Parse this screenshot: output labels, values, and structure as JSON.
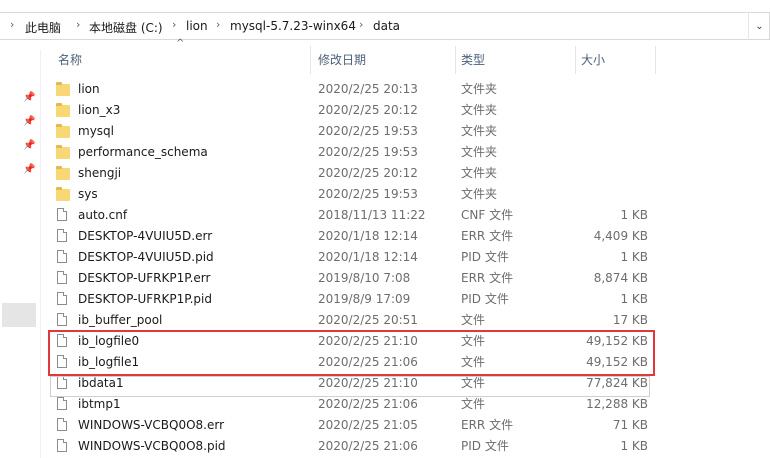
{
  "breadcrumb": {
    "items": [
      "此电脑",
      "本地磁盘 (C:)",
      "lion",
      "mysql-5.7.23-winx64",
      "data"
    ]
  },
  "columns": {
    "name": "名称",
    "modified": "修改日期",
    "type": "类型",
    "size": "大小"
  },
  "rows": [
    {
      "name": "lion",
      "modified": "2020/2/25 20:13",
      "type": "文件夹",
      "size": "",
      "icon": "folder-icon"
    },
    {
      "name": "lion_x3",
      "modified": "2020/2/25 20:12",
      "type": "文件夹",
      "size": "",
      "icon": "folder-icon"
    },
    {
      "name": "mysql",
      "modified": "2020/2/25 19:53",
      "type": "文件夹",
      "size": "",
      "icon": "folder-icon"
    },
    {
      "name": "performance_schema",
      "modified": "2020/2/25 19:53",
      "type": "文件夹",
      "size": "",
      "icon": "folder-icon"
    },
    {
      "name": "shengji",
      "modified": "2020/2/25 20:12",
      "type": "文件夹",
      "size": "",
      "icon": "folder-icon"
    },
    {
      "name": "sys",
      "modified": "2020/2/25 19:53",
      "type": "文件夹",
      "size": "",
      "icon": "folder-icon"
    },
    {
      "name": "auto.cnf",
      "modified": "2018/11/13 11:22",
      "type": "CNF 文件",
      "size": "1 KB",
      "icon": "file-icon"
    },
    {
      "name": "DESKTOP-4VUIU5D.err",
      "modified": "2020/1/18 12:14",
      "type": "ERR 文件",
      "size": "4,409 KB",
      "icon": "file-icon"
    },
    {
      "name": "DESKTOP-4VUIU5D.pid",
      "modified": "2020/1/18 12:14",
      "type": "PID 文件",
      "size": "1 KB",
      "icon": "file-icon"
    },
    {
      "name": "DESKTOP-UFRKP1P.err",
      "modified": "2019/8/10 7:08",
      "type": "ERR 文件",
      "size": "8,874 KB",
      "icon": "file-icon"
    },
    {
      "name": "DESKTOP-UFRKP1P.pid",
      "modified": "2019/8/9 17:09",
      "type": "PID 文件",
      "size": "1 KB",
      "icon": "file-icon"
    },
    {
      "name": "ib_buffer_pool",
      "modified": "2020/2/25 20:51",
      "type": "文件",
      "size": "17 KB",
      "icon": "file-icon"
    },
    {
      "name": "ib_logfile0",
      "modified": "2020/2/25 21:10",
      "type": "文件",
      "size": "49,152 KB",
      "icon": "file-icon"
    },
    {
      "name": "ib_logfile1",
      "modified": "2020/2/25 21:06",
      "type": "文件",
      "size": "49,152 KB",
      "icon": "file-icon"
    },
    {
      "name": "ibdata1",
      "modified": "2020/2/25 21:10",
      "type": "文件",
      "size": "77,824 KB",
      "icon": "file-icon"
    },
    {
      "name": "ibtmp1",
      "modified": "2020/2/25 21:06",
      "type": "文件",
      "size": "12,288 KB",
      "icon": "file-icon"
    },
    {
      "name": "WINDOWS-VCBQ0O8.err",
      "modified": "2020/2/25 21:05",
      "type": "ERR 文件",
      "size": "71 KB",
      "icon": "file-icon"
    },
    {
      "name": "WINDOWS-VCBQ0O8.pid",
      "modified": "2020/2/25 21:06",
      "type": "PID 文件",
      "size": "1 KB",
      "icon": "file-icon"
    }
  ]
}
